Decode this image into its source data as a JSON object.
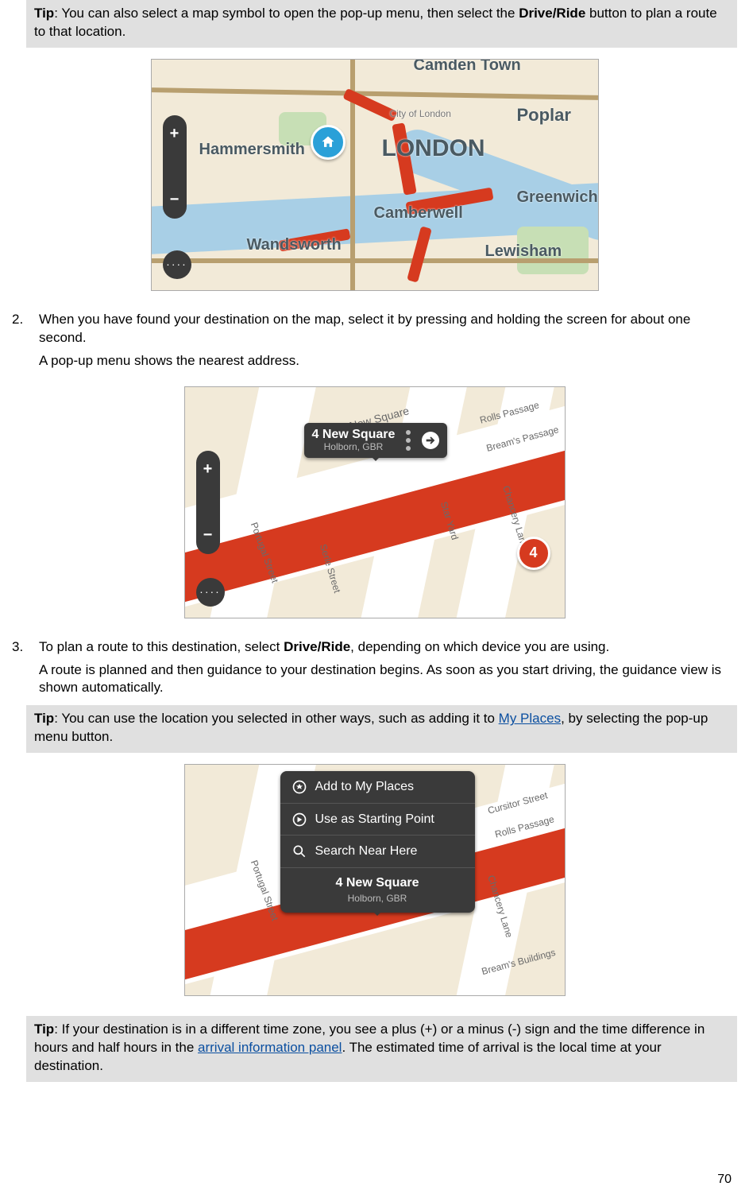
{
  "tips": {
    "tip1": {
      "label": "Tip",
      "before_bold": ": You can also select a map symbol to open the pop-up menu, then select the ",
      "bold": "Drive/Ride",
      "after_bold": " button to plan a route to that location."
    },
    "tip2": {
      "label": "Tip",
      "before_link": ": You can use the location you selected in other ways, such as adding it to ",
      "link_text": "My Places",
      "after_link": ", by selecting the pop-up menu button."
    },
    "tip3": {
      "label": "Tip",
      "before_link": ": If your destination is in a different time zone, you see a plus (+) or a minus (-) sign and the time difference in hours and half hours in the ",
      "link_text": "arrival information panel",
      "after_link": ". The estimated time of arrival is the local time at your destination."
    }
  },
  "steps": {
    "s2": {
      "num": "2.",
      "p1": "When you have found your destination on the map, select it by pressing and holding the screen for about one second.",
      "p2": "A pop-up menu shows the nearest address."
    },
    "s3": {
      "num": "3.",
      "p1_before": "To plan a route to this destination, select ",
      "p1_bold": "Drive/Ride",
      "p1_after": ", depending on which device you are using.",
      "p2": "A route is planned and then guidance to your destination begins. As soon as you start driving, the guidance view is shown automatically."
    }
  },
  "map1": {
    "labels": {
      "camden": "Camden Town",
      "city_of_london": "City of London",
      "london": "LONDON",
      "hammersmith": "Hammersmith",
      "poplar": "Poplar",
      "greenwich": "Greenwich",
      "camberwell": "Camberwell",
      "wandsworth": "Wandsworth",
      "lewisham": "Lewisham"
    },
    "zoom_in": "+",
    "zoom_out": "−",
    "more": "····"
  },
  "map2": {
    "popup": {
      "title": "4 New Square",
      "subtitle": "Holborn, GBR"
    },
    "streets": {
      "portugal": "Portugal Street",
      "serle": "Serle Street",
      "new_square": "New Square",
      "star_yard": "Star Yard",
      "chancery": "Chancery Lane",
      "rolls": "Rolls Passage",
      "breams": "Bream's Passage"
    },
    "badge": "4",
    "zoom_in": "+",
    "zoom_out": "−",
    "more": "····"
  },
  "map3": {
    "menu": {
      "add": "Add to My Places",
      "start": "Use as Starting Point",
      "search": "Search Near Here"
    },
    "addr": {
      "title": "4 New Square",
      "subtitle": "Holborn, GBR"
    },
    "streets": {
      "portugal": "Portugal Street",
      "cursitor": "Cursitor Street",
      "rolls": "Rolls Passage",
      "chancery": "Chancery Lane",
      "breams": "Bream's Buildings"
    }
  },
  "page_number": "70"
}
